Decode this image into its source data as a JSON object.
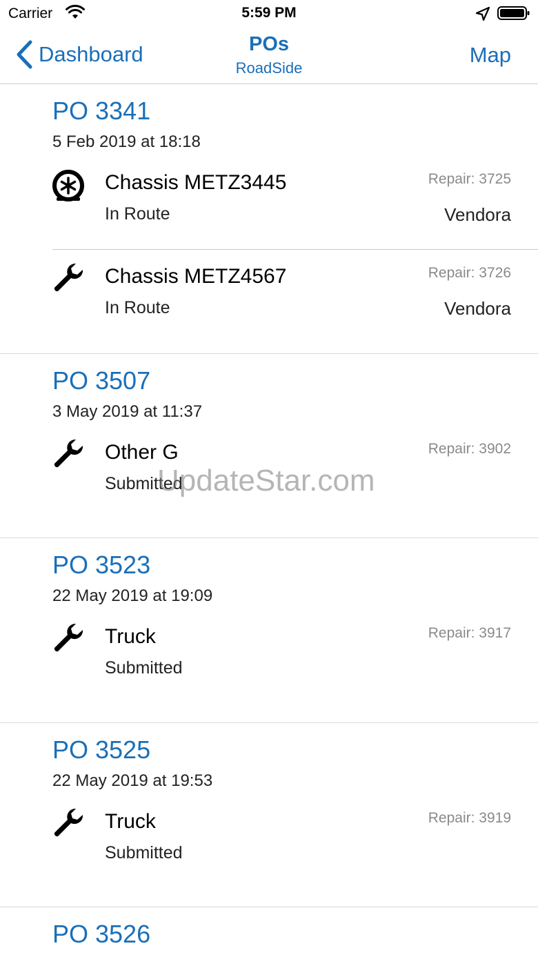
{
  "status_bar": {
    "carrier": "Carrier",
    "time": "5:59 PM"
  },
  "nav": {
    "back_label": "Dashboard",
    "title": "POs",
    "subtitle": "RoadSide",
    "map_label": "Map"
  },
  "colors": {
    "accent": "#1a6fb8",
    "separator": "#d8d8dc",
    "secondary_text": "#8a8a8a"
  },
  "pos": [
    {
      "title": "PO 3341",
      "date": "5 Feb 2019 at 18:18",
      "repairs": [
        {
          "icon": "tire-icon",
          "name": "Chassis METZ3445",
          "status": "In Route",
          "repair": "Repair: 3725",
          "vendor": "Vendora"
        },
        {
          "icon": "wrench-icon",
          "name": "Chassis METZ4567",
          "status": "In Route",
          "repair": "Repair: 3726",
          "vendor": "Vendora"
        }
      ]
    },
    {
      "title": "PO 3507",
      "date": "3 May 2019 at 11:37",
      "repairs": [
        {
          "icon": "wrench-icon",
          "name": "Other G",
          "status": "Submitted",
          "repair": "Repair: 3902",
          "vendor": ""
        }
      ]
    },
    {
      "title": "PO 3523",
      "date": "22 May 2019 at 19:09",
      "repairs": [
        {
          "icon": "wrench-icon",
          "name": "Truck",
          "status": "Submitted",
          "repair": "Repair: 3917",
          "vendor": ""
        }
      ]
    },
    {
      "title": "PO 3525",
      "date": "22 May 2019 at 19:53",
      "repairs": [
        {
          "icon": "wrench-icon",
          "name": "Truck",
          "status": "Submitted",
          "repair": "Repair: 3919",
          "vendor": ""
        }
      ]
    },
    {
      "title": "PO 3526",
      "date": "",
      "repairs": []
    }
  ],
  "watermark": "UpdateStar.com"
}
